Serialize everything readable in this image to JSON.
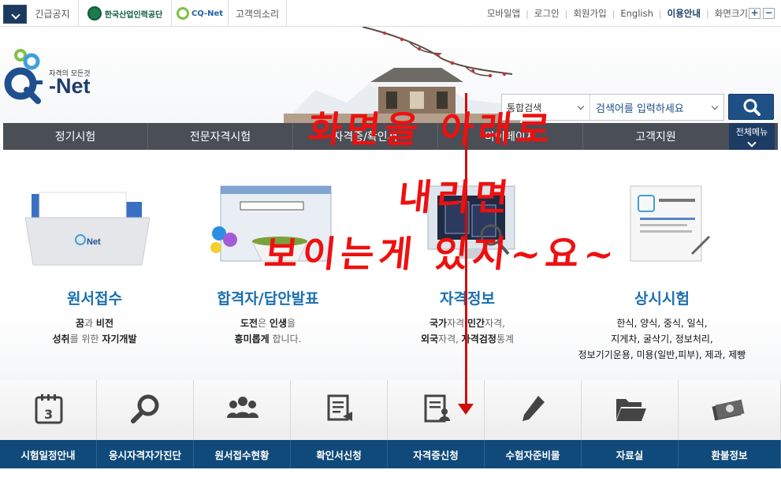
{
  "topbar": {
    "emergency": "긴급공지",
    "hrdk_name": "한국산업인력공단",
    "cqnet": "CQ-Net",
    "voc": "고객의소리",
    "links": [
      "모바일앱",
      "로그인",
      "회원가입",
      "English"
    ],
    "guide": "이용안내",
    "zoom_label": "화면크기",
    "zoom_in": "+",
    "zoom_out": "−"
  },
  "header": {
    "logo_tagline": "자격의 모든것",
    "logo_name": "Net",
    "search_scope": "통합검색",
    "search_placeholder": "검색어를 입력하세요"
  },
  "nav": {
    "items": [
      "정기시험",
      "전문자격시험",
      "자격증/확인서",
      "마이페이지",
      "고객지원"
    ],
    "all_menu": "전체메뉴"
  },
  "services": [
    {
      "title": "원서접수",
      "lines": [
        [
          "꿈",
          "과 ",
          "비전"
        ],
        [
          "성취",
          "를 위한 ",
          "자기개발"
        ]
      ]
    },
    {
      "title": "합격자/답안발표",
      "lines": [
        [
          "도전",
          "은 ",
          "인생"
        ],
        [
          "흥미롭게",
          " 합니다.",
          ""
        ]
      ]
    },
    {
      "title": "자격정보",
      "lines": [
        [
          "국가",
          "자격 ",
          "민간"
        ],
        [
          "외국",
          "자격, ",
          "자격검정"
        ]
      ]
    },
    {
      "title": "상시시험",
      "lines": [
        [
          "한식, 양식, 중식, 일식,",
          "",
          ""
        ],
        [
          "지게차, 굴삭기, 정보처리,",
          "",
          ""
        ],
        [
          "정보기기운용, 미용(일반,피부), 제과, 제빵",
          "",
          ""
        ]
      ]
    }
  ],
  "service_suffix": {
    "s1_line1": "자격,",
    "s3_line2": "통계"
  },
  "quick_menu": [
    "시험일정안내",
    "응시자격자가진단",
    "원서접수현황",
    "확인서신청",
    "자격증신청",
    "수험자준비물",
    "자료실",
    "환불정보"
  ],
  "annotation": {
    "line1": "화면을 아래로",
    "line2": "내리면",
    "line3": "보이는게 있지~요~"
  },
  "colors": {
    "nav_bg": "#4a4e55",
    "quick_label_bg": "#0f4a7a",
    "title_blue": "#1b6fb0",
    "annotation_red": "#ee1010"
  }
}
